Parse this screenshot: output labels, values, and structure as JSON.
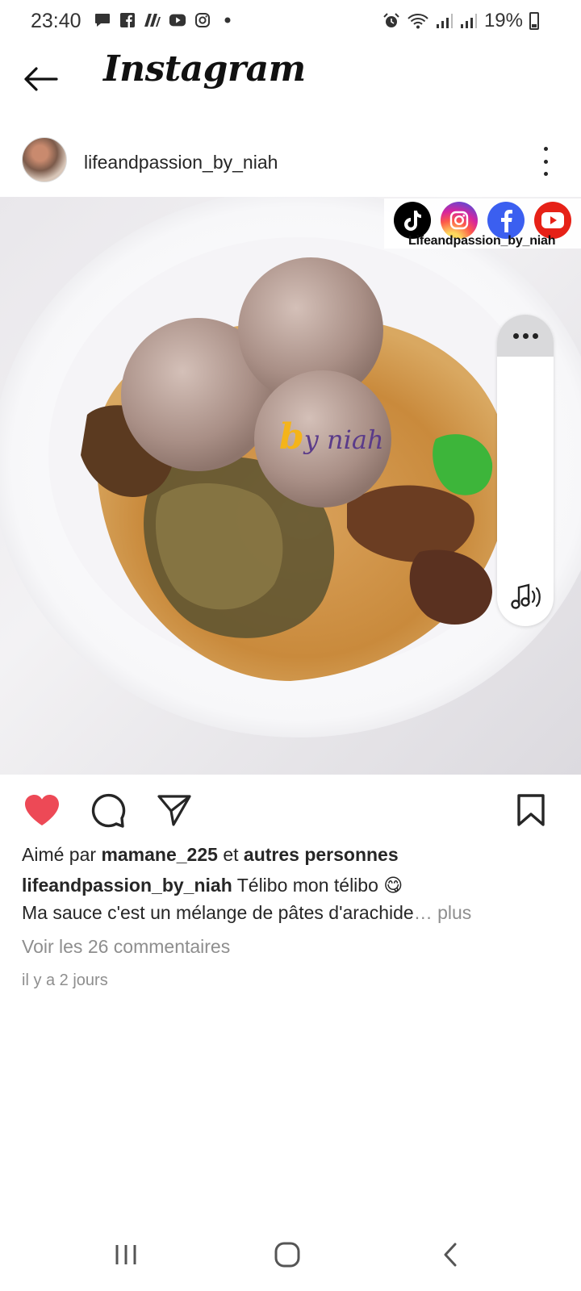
{
  "status_bar": {
    "time": "23:40",
    "left_icons": [
      "message-icon",
      "facebook-icon",
      "notification-icon",
      "youtube-icon",
      "instagram-icon",
      "dot-icon"
    ],
    "right_icons": [
      "alarm-icon",
      "wifi-icon",
      "signal-icon",
      "signal-icon"
    ],
    "battery": "19%"
  },
  "header": {
    "title": "Instagram",
    "back_icon": "arrow-left-icon"
  },
  "post": {
    "username": "lifeandpassion_by_niah",
    "image": {
      "social_handle": "Lifeandpassion_by_niah",
      "social_icons": [
        "tiktok-icon",
        "instagram-icon",
        "facebook-icon",
        "youtube-icon"
      ],
      "watermark_prefix": "b",
      "watermark_text": "y niah"
    },
    "actions": {
      "like_icon": "heart-filled-icon",
      "comment_icon": "comment-icon",
      "share_icon": "send-icon",
      "save_icon": "bookmark-icon",
      "like_color": "#ed4956"
    },
    "likes_prefix": "Aimé par ",
    "likes_user": "mamane_225",
    "likes_middle": " et ",
    "likes_suffix": "autres personnes",
    "caption_user": "lifeandpassion_by_niah",
    "caption_text": " Télibo mon télibo 😋",
    "caption_line2": "Ma sauce c'est un mélange de pâtes d'arachide",
    "caption_more": "… plus",
    "comments_link": "Voir les 26 commentaires",
    "timestamp": "il y a 2 jours"
  },
  "nav_bar": {
    "recent_icon": "recent-apps-icon",
    "home_icon": "home-icon",
    "back_icon": "nav-back-icon"
  }
}
